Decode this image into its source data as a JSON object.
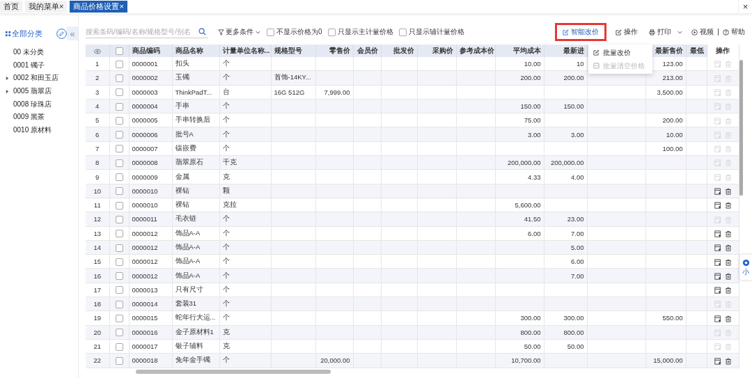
{
  "tabs": [
    {
      "label": "首页",
      "selected": false
    },
    {
      "label": "我的菜单",
      "close": "×",
      "selected": false
    },
    {
      "label": "商品价格设置",
      "close": "×",
      "selected": true
    }
  ],
  "close_glyph": "×",
  "sidebar": {
    "title": "全部分类",
    "collapse_glyph": "«",
    "items": [
      {
        "label": "00 未分类",
        "expandable": false
      },
      {
        "label": "0001 镯子",
        "expandable": false
      },
      {
        "label": "0002 和田玉店",
        "expandable": true
      },
      {
        "label": "0005 翡翠店",
        "expandable": true
      },
      {
        "label": "0008 珍珠店",
        "expandable": false
      },
      {
        "label": "0009 黑茶",
        "expandable": false
      },
      {
        "label": "0010 原材料",
        "expandable": false
      }
    ]
  },
  "toolbar": {
    "search": {
      "placeholder": "搜索条码/编码/名称/规格型号/别名"
    },
    "more_filters": "更多条件",
    "options": [
      {
        "label": "不显示价格为0",
        "checked": false
      },
      {
        "label": "只显示主计量价格",
        "checked": false
      },
      {
        "label": "只显示辅计量价格",
        "checked": false
      }
    ],
    "actions": [
      {
        "label": "智能改价",
        "kind": "smart",
        "highlighted": true
      },
      {
        "label": "操作",
        "kind": "edit",
        "highlighted": false
      },
      {
        "label": "打印",
        "kind": "print",
        "highlighted": false
      },
      {
        "label": "视频",
        "kind": "video",
        "highlighted": false
      },
      {
        "label": "帮助",
        "kind": "help",
        "highlighted": false
      }
    ],
    "menu": [
      {
        "label": "批量改价",
        "disabled": false
      },
      {
        "label": "批量清空价格",
        "disabled": true
      }
    ]
  },
  "table": {
    "select_all_checked": false,
    "columns": {
      "code": "商品编码",
      "name": "商品名称",
      "unit": "计量单位名称...",
      "spec": "规格型号",
      "retail_price": "零售价",
      "member_price": "会员价",
      "wholesale_price": "批发价",
      "purchase_price": "采购价",
      "reference_cost": "参考成本价",
      "avg_cost": "平均成本",
      "latest_purchase_price": "最新进",
      "latest_sale_price": "最新售价",
      "lowest_price": "最低",
      "actions": "操作"
    },
    "rows": [
      {
        "no": "1",
        "checked": false,
        "code": "0000001",
        "name": "扣头",
        "unit": "个",
        "avg_cost": "10.00",
        "latest_purchase_price": "10",
        "latest_sale_price": "123.00",
        "actions_active": false
      },
      {
        "no": "2",
        "checked": false,
        "code": "0000002",
        "name": "玉镯",
        "unit": "个",
        "spec": "首饰-14KY...",
        "avg_cost": "200.00",
        "latest_purchase_price": "200.00",
        "latest_sale_price": "213.00",
        "actions_active": false
      },
      {
        "no": "3",
        "checked": false,
        "code": "0000003",
        "name": "ThinkPadT...",
        "unit": "台",
        "spec": "16G 512G",
        "retail_price": "7,999.00",
        "latest_sale_price": "3,500.00",
        "actions_active": false
      },
      {
        "no": "4",
        "checked": false,
        "code": "0000004",
        "name": "手串",
        "unit": "个",
        "avg_cost": "150.00",
        "latest_purchase_price": "150.00",
        "actions_active": false
      },
      {
        "no": "5",
        "checked": false,
        "code": "0000005",
        "name": "手串转换后",
        "unit": "个",
        "avg_cost": "75.00",
        "latest_sale_price": "200.00",
        "actions_active": false
      },
      {
        "no": "6",
        "checked": false,
        "code": "0000006",
        "name": "批号A",
        "unit": "个",
        "avg_cost": "3.00",
        "latest_purchase_price": "3.00",
        "latest_sale_price": "10.00",
        "actions_active": false
      },
      {
        "no": "7",
        "checked": false,
        "code": "0000007",
        "name": "镶嵌费",
        "unit": "个",
        "latest_sale_price": "100.00",
        "actions_active": false
      },
      {
        "no": "8",
        "checked": false,
        "code": "0000008",
        "name": "翡翠原石",
        "unit": "千克",
        "avg_cost": "200,000.00",
        "latest_purchase_price": "200,000.00",
        "actions_active": false
      },
      {
        "no": "9",
        "checked": false,
        "code": "0000009",
        "name": "金属",
        "unit": "克",
        "avg_cost": "4.33",
        "latest_purchase_price": "4.00",
        "actions_active": false
      },
      {
        "no": "10",
        "checked": false,
        "code": "0000010",
        "name": "裸钻",
        "unit": "颗",
        "actions_active": true
      },
      {
        "no": "11",
        "checked": false,
        "code": "0000010",
        "name": "裸钻",
        "unit": "克拉",
        "avg_cost": "5,600.00",
        "actions_active": true
      },
      {
        "no": "12",
        "checked": false,
        "code": "0000011",
        "name": "毛衣链",
        "unit": "个",
        "avg_cost": "41.50",
        "latest_purchase_price": "23.00",
        "actions_active": false
      },
      {
        "no": "13",
        "checked": false,
        "code": "0000012",
        "name": "饰品A-A",
        "unit": "个",
        "avg_cost": "6.00",
        "latest_purchase_price": "7.00",
        "actions_active": true
      },
      {
        "no": "14",
        "checked": false,
        "code": "0000012",
        "name": "饰品A-A",
        "unit": "个",
        "latest_purchase_price": "5.00",
        "actions_active": true
      },
      {
        "no": "15",
        "checked": false,
        "code": "0000012",
        "name": "饰品A-A",
        "unit": "个",
        "latest_purchase_price": "6.00",
        "actions_active": true
      },
      {
        "no": "16",
        "checked": false,
        "code": "0000012",
        "name": "饰品A-A",
        "unit": "个",
        "latest_purchase_price": "7.00",
        "actions_active": true
      },
      {
        "no": "17",
        "checked": false,
        "code": "0000013",
        "name": "只有尺寸",
        "unit": "个",
        "actions_active": true
      },
      {
        "no": "18",
        "checked": false,
        "code": "0000014",
        "name": "套装31",
        "unit": "个",
        "actions_active": false
      },
      {
        "no": "19",
        "checked": false,
        "code": "0000015",
        "name": "蛇年行大运...",
        "unit": "个",
        "avg_cost": "300.00",
        "latest_purchase_price": "300.00",
        "latest_sale_price": "550.00",
        "actions_active": true
      },
      {
        "no": "20",
        "checked": false,
        "code": "0000016",
        "name": "金子原材料1",
        "unit": "克",
        "avg_cost": "800.00",
        "latest_purchase_price": "800.00",
        "actions_active": false
      },
      {
        "no": "21",
        "checked": false,
        "code": "0000017",
        "name": "银子辅料",
        "unit": "克",
        "avg_cost": "50.00",
        "latest_purchase_price": "50.00",
        "actions_active": false
      },
      {
        "no": "22",
        "checked": false,
        "code": "0000018",
        "name": "兔年金手镯",
        "unit": "个",
        "retail_price": "20,000.00",
        "avg_cost": "10,700.00",
        "latest_sale_price": "15,000.00",
        "actions_active": true
      }
    ]
  },
  "float_widget": {
    "label": "小"
  }
}
